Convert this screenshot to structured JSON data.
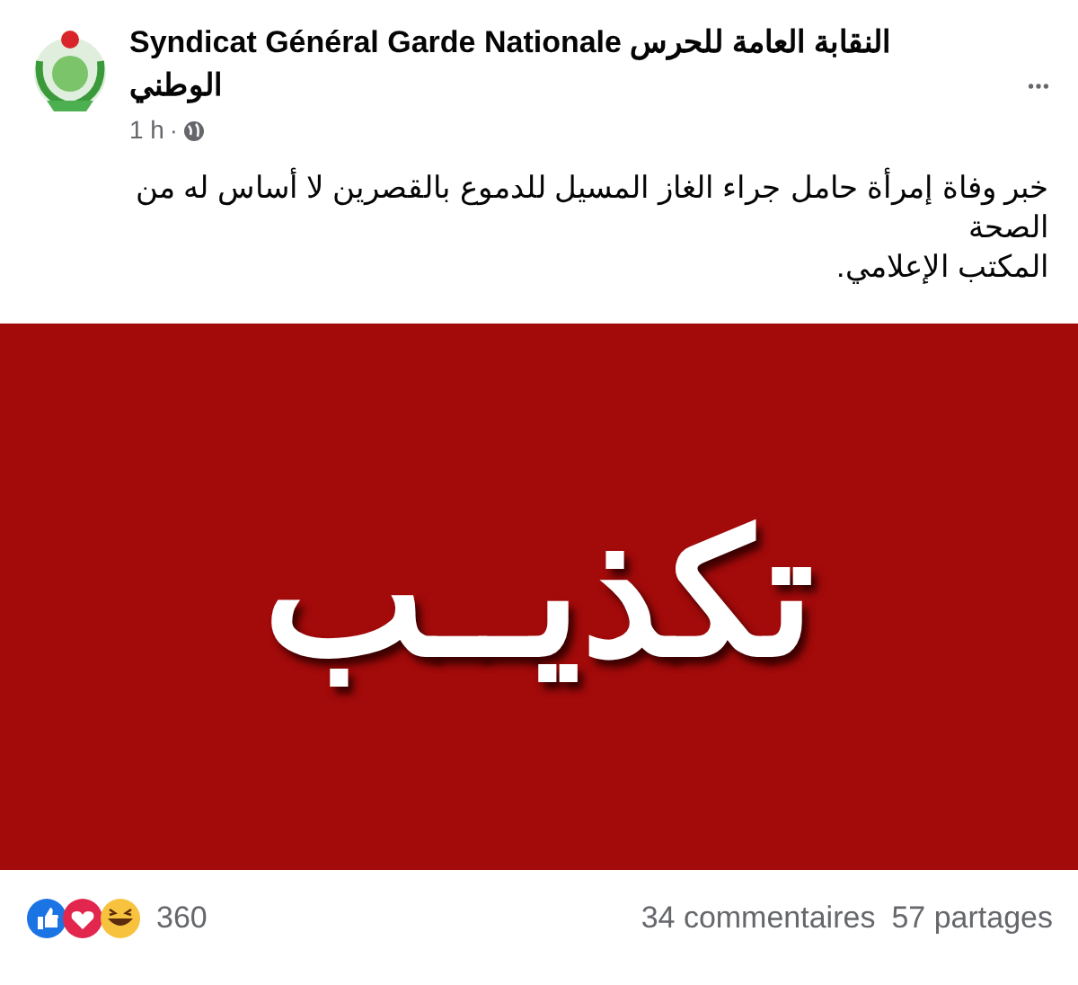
{
  "post": {
    "author": "Syndicat Général Garde Nationale النقابة العامة للحرس الوطني",
    "time": "1 h",
    "separator": "·",
    "paragraphs": [
      "خبر وفاة إمرأة حامل جراء الغاز المسيل للدموع بالقصرين لا أساس له من الصحة",
      "المكتب الإعلامي."
    ],
    "image_text": "تكذيــب"
  },
  "footer": {
    "reactions_count": "360",
    "comments": "34 commentaires",
    "shares": "57 partages"
  }
}
